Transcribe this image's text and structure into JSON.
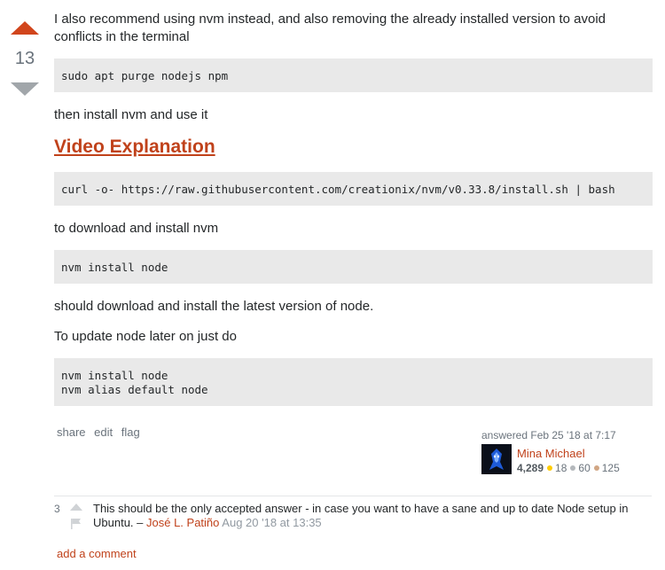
{
  "vote": {
    "score": "13",
    "upvote_color": "#d1451c",
    "downvote_color": "#a1a6aa"
  },
  "post": {
    "intro": "I also recommend using nvm instead, and also removing the already installed version to avoid conflicts in the terminal",
    "code1": "sudo apt purge nodejs npm",
    "then_install": "then install nvm and use it",
    "video_link": "Video Explanation",
    "code2": "curl -o- https://raw.githubusercontent.com/creationix/nvm/v0.33.8/install.sh | bash",
    "download_text": "to download and install nvm",
    "code3": "nvm install node",
    "latest_text": "should download and install the latest version of node.",
    "update_text": "To update node later on just do",
    "code4": "nvm install node\nnvm alias default node"
  },
  "menu": {
    "share": "share",
    "edit": "edit",
    "flag": "flag"
  },
  "signature": {
    "answered": "answered Feb 25 '18 at 7:17",
    "user": "Mina Michael",
    "reputation": "4,289",
    "gold": "18",
    "silver": "60",
    "bronze": "125",
    "gold_color": "#ffcc01",
    "silver_color": "#b4b8bc",
    "bronze_color": "#d1a684"
  },
  "comment": {
    "score": "3",
    "text": "This should be the only accepted answer - in case you want to have a sane and up to date Node setup in Ubuntu. – ",
    "user": "José L. Patiño",
    "date": "Aug 20 '18 at 13:35"
  },
  "add_comment": "add a comment",
  "icons": {
    "upvote": "arrow-up-icon",
    "downvote": "arrow-down-icon",
    "flag": "flag-icon"
  }
}
